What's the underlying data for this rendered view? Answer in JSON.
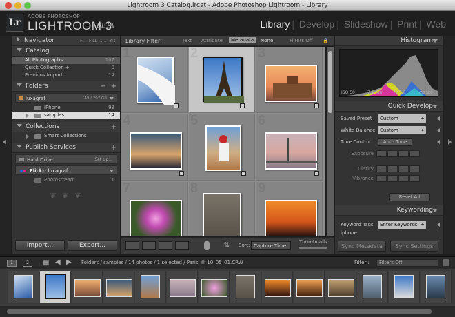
{
  "window": {
    "title": "Lightroom 3 Catalog.lrcat - Adobe Photoshop Lightroom - Library"
  },
  "identity": {
    "logo": "Lr",
    "brand_top": "ADOBE PHOTOSHOP",
    "brand_main": "LIGHTROOM 3",
    "brand_beta": "BETA"
  },
  "modules": [
    "Library",
    "Develop",
    "Slideshow",
    "Print",
    "Web"
  ],
  "navigator": {
    "title": "Navigator",
    "opts": "FIT  FILL  1:1  3:1"
  },
  "catalog": {
    "title": "Catalog",
    "items": [
      {
        "label": "All Photographs",
        "count": "107"
      },
      {
        "label": "Quick Collection +",
        "count": "0"
      },
      {
        "label": "Previous Import",
        "count": "14"
      }
    ]
  },
  "folders": {
    "title": "Folders",
    "drive": {
      "name": "luxagraf",
      "size": "49 / 297 GB"
    },
    "items": [
      {
        "label": "iPhone",
        "count": "93"
      },
      {
        "label": "samples",
        "count": "14"
      }
    ]
  },
  "collections": {
    "title": "Collections",
    "smart": "Smart Collections"
  },
  "publish": {
    "title": "Publish Services",
    "hard_drive": "Hard Drive",
    "hard_drive_action": "Set Up...",
    "flickr": "Flickr",
    "flickr_user": ": luxagraf",
    "photostream": "Photostream",
    "photostream_count": "1"
  },
  "buttons": {
    "import": "Import...",
    "export": "Export...",
    "sync_metadata": "Sync Metadata",
    "sync_settings": "Sync Settings"
  },
  "filter": {
    "label": "Library Filter :",
    "options": [
      "Text",
      "Attribute",
      "Metadata",
      "None"
    ],
    "active": "Metadata",
    "preset": "Filters Off"
  },
  "grid": {
    "cells": [
      {
        "num": "1"
      },
      {
        "num": "2"
      },
      {
        "num": "3"
      },
      {
        "num": "4"
      },
      {
        "num": "5"
      },
      {
        "num": "6"
      },
      {
        "num": "7"
      },
      {
        "num": "8"
      },
      {
        "num": "9"
      }
    ],
    "selected_index": 1
  },
  "toolbar": {
    "sort_label": "Sort:",
    "sort_value": "Capture Time",
    "thumb_label": "Thumbnails"
  },
  "histogram": {
    "title": "Histogram",
    "iso": "ISO 50",
    "focal": "7.1 mm",
    "aperture": "f / 5.6",
    "shutter": "1/60 SEC"
  },
  "quick_develop": {
    "title": "Quick Develop",
    "saved_preset_label": "Saved Preset",
    "saved_preset_value": "Custom",
    "white_balance_label": "White Balance",
    "white_balance_value": "Custom",
    "tone_control_label": "Tone Control",
    "auto_tone": "Auto Tone",
    "adjustments": [
      "Exposure",
      "Clarity",
      "Vibrance"
    ],
    "reset_all": "Reset All"
  },
  "keywording": {
    "title": "Keywording",
    "tags_label": "Keyword Tags",
    "tags_value": "Enter Keywords",
    "keyword": "iphone"
  },
  "filmbar": {
    "screen1": "1",
    "screen2": "2",
    "breadcrumb": "Folders / samples / 14 photos / 1 selected / Paris_ill_10_05_01.CRW",
    "filter_label": "Filter :",
    "filter_value": "Filters Off"
  },
  "colors": {
    "accent_selected": "#dcdcdc",
    "panel_bg": "#333333",
    "grid_bg": "#8e8e8e"
  }
}
